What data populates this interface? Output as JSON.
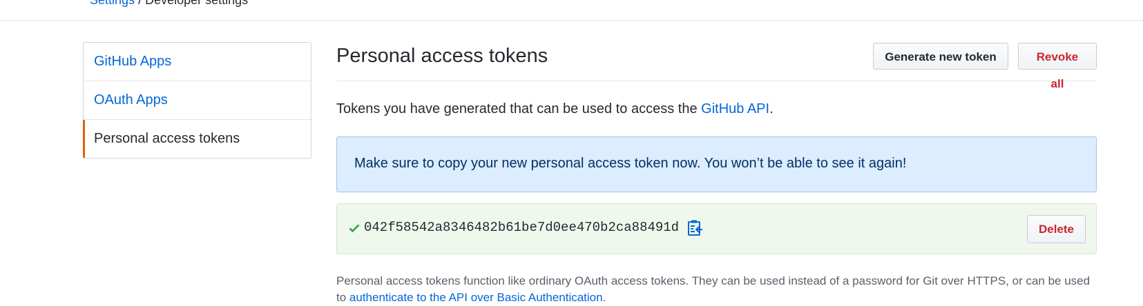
{
  "topbar": {
    "link_text": "Settings",
    "separator": "/",
    "current": "Developer settings"
  },
  "sidenav": {
    "items": [
      {
        "label": "GitHub Apps"
      },
      {
        "label": "OAuth Apps"
      },
      {
        "label": "Personal access tokens"
      }
    ]
  },
  "header": {
    "title": "Personal access tokens",
    "generate_label": "Generate new token",
    "revoke_label": "Revoke all"
  },
  "intro": {
    "text": "Tokens you have generated that can be used to access the ",
    "link": "GitHub API",
    "suffix": "."
  },
  "flash": {
    "text": "Make sure to copy your new personal access token now. You won’t be able to see it again!"
  },
  "token": {
    "value": "042f58542a8346482b61be7d0ee470b2ca88491d",
    "delete_label": "Delete"
  },
  "note": {
    "text": "Personal access tokens function like ordinary OAuth access tokens. They can be used instead of a password for Git over HTTPS, or can be used to ",
    "link": "authenticate to the API over Basic Authentication",
    "suffix": "."
  },
  "colors": {
    "accent_link": "#0366d6",
    "danger": "#cb2431",
    "selected_marker": "#e36209",
    "flash_bg": "#dbedff",
    "token_bg": "#f0f7ed",
    "check": "#28a745"
  }
}
